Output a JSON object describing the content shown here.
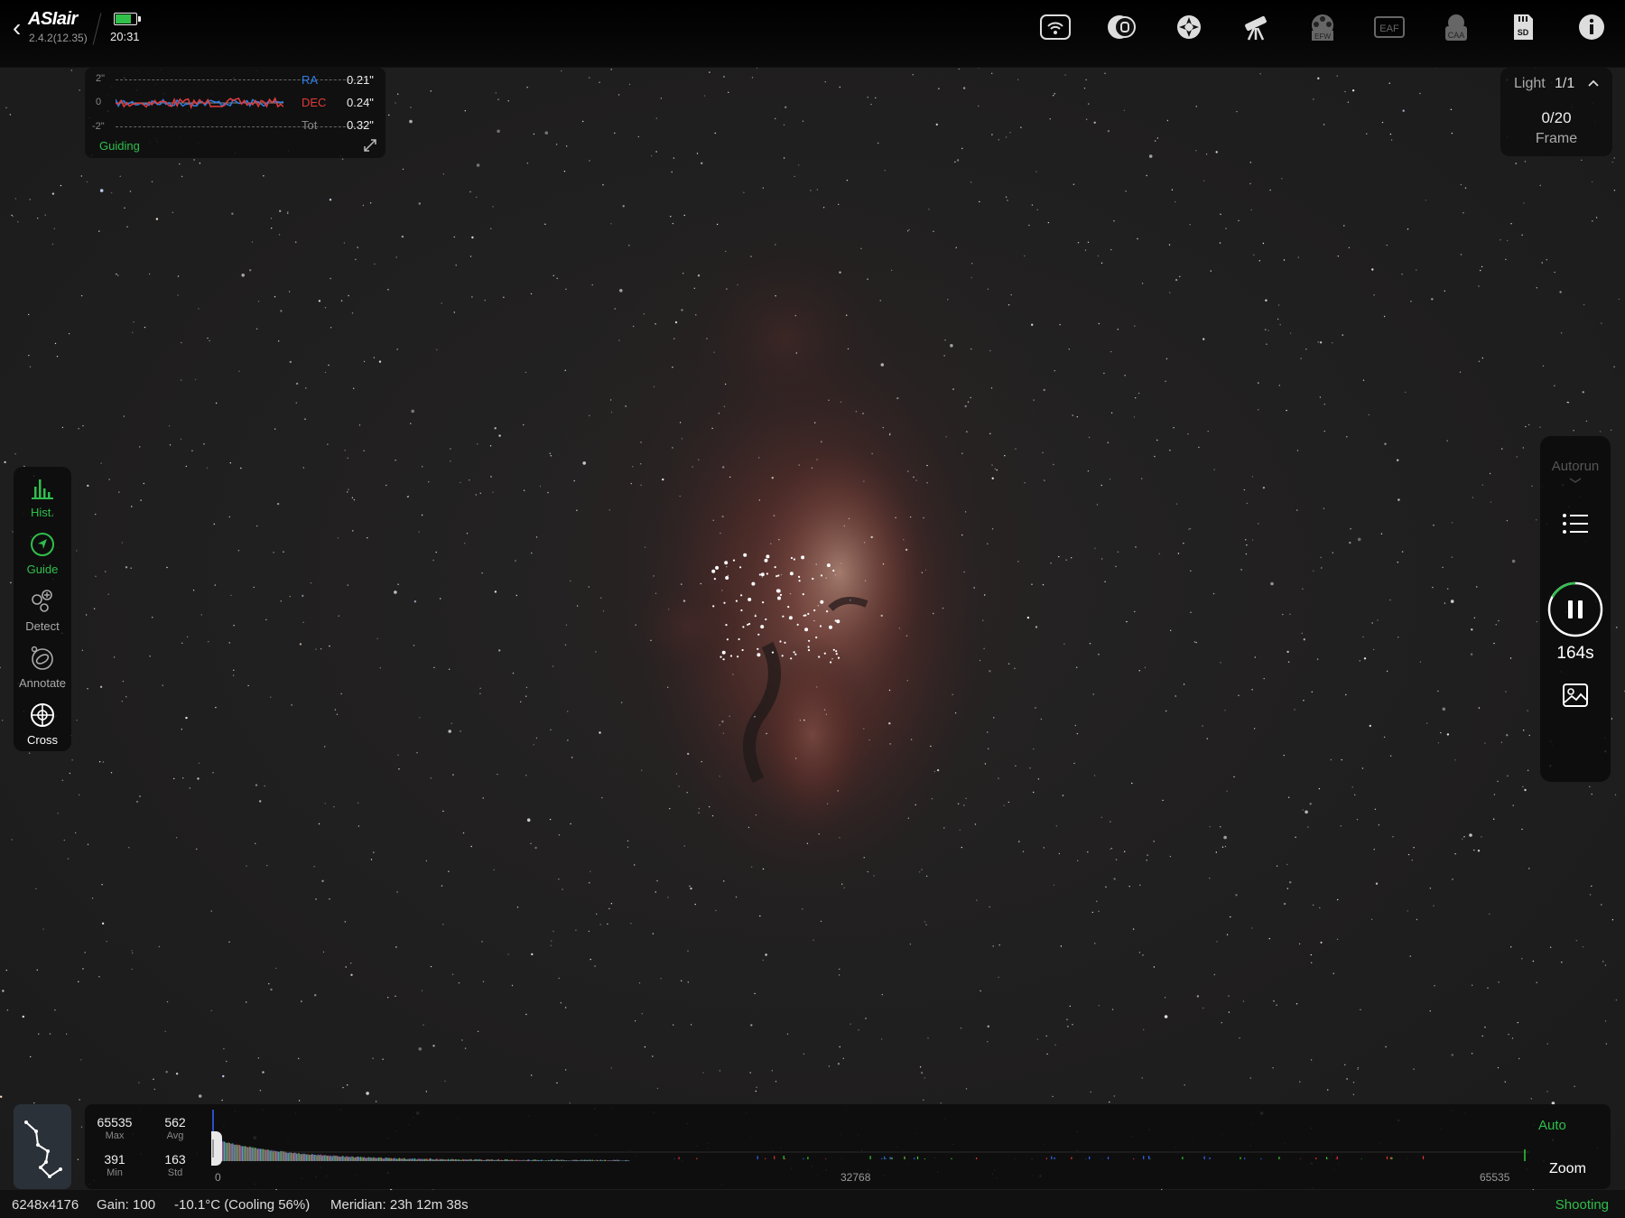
{
  "app": {
    "logo": "ASIair",
    "version": "2.4.2(12.35)",
    "time": "20:31",
    "battery_level": 0.75,
    "accent": "#2fbf4c"
  },
  "top_icons": [
    {
      "name": "wifi-icon"
    },
    {
      "name": "camera-icon"
    },
    {
      "name": "guide-scope-icon"
    },
    {
      "name": "telescope-mount-icon"
    },
    {
      "name": "filter-wheel-icon",
      "text": "EFW"
    },
    {
      "name": "focuser-icon",
      "text": "EAF"
    },
    {
      "name": "rotator-icon",
      "text": "CAA"
    },
    {
      "name": "sd-card-icon",
      "text": "SD"
    },
    {
      "name": "info-icon"
    }
  ],
  "guiding": {
    "y_ticks": [
      "2\"",
      "0",
      "-2\""
    ],
    "ra_label": "RA",
    "dec_label": "DEC",
    "tot_label": "Tot",
    "ra_value": "0.21\"",
    "dec_value": "0.24\"",
    "tot_value": "0.32\"",
    "status": "Guiding",
    "ra_color": "#2f7fe6",
    "dec_color": "#e23b3b"
  },
  "frame": {
    "type": "Light",
    "index": "1/1",
    "count": "0/20",
    "label": "Frame"
  },
  "left_tools": [
    {
      "name": "hist",
      "label": "Hist.",
      "active": true
    },
    {
      "name": "guide",
      "label": "Guide",
      "active": true
    },
    {
      "name": "detect",
      "label": "Detect",
      "active": false
    },
    {
      "name": "annotate",
      "label": "Annotate",
      "active": false
    },
    {
      "name": "cross",
      "label": "Cross",
      "active": false
    }
  ],
  "right_panel": {
    "autorun": "Autorun",
    "exposure_remaining": "164s"
  },
  "histogram": {
    "max": "65535",
    "max_label": "Max",
    "avg": "562",
    "avg_label": "Avg",
    "min": "391",
    "min_label": "Min",
    "std": "163",
    "std_label": "Std",
    "tick_start": "0",
    "tick_mid": "32768",
    "tick_end": "65535",
    "auto": "Auto",
    "zoom": "Zoom"
  },
  "status": {
    "resolution": "6248x4176",
    "gain": "Gain: 100",
    "temperature": "-10.1°C (Cooling 56%)",
    "meridian": "Meridian: 23h 12m 38s",
    "state": "Shooting"
  }
}
